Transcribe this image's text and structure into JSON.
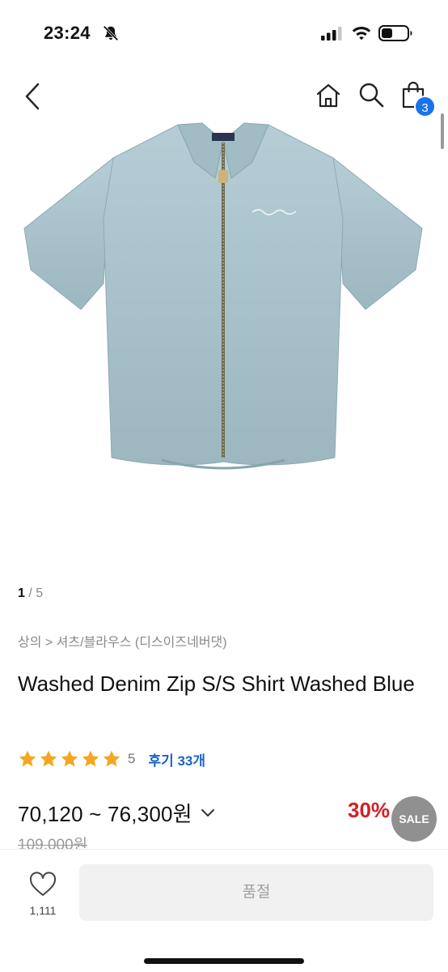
{
  "status_bar": {
    "time": "23:24",
    "icons": [
      "bell-slash-icon",
      "signal-icon",
      "wifi-icon",
      "battery-icon"
    ]
  },
  "header": {
    "icons": [
      "back-icon",
      "home-icon",
      "search-icon",
      "shopping-bag-icon"
    ],
    "cart_count": "3"
  },
  "gallery": {
    "current": "1",
    "separator": " / ",
    "total": "5"
  },
  "product": {
    "breadcrumb": "상의 > 셔츠/블라우스 (디스이즈네버댓)",
    "title": "Washed Denim Zip S/S Shirt Washed Blue",
    "rating": {
      "stars": 5,
      "value": "5",
      "review_label": "후기 33개"
    },
    "price_range": "70,120 ~ 76,300원",
    "discount": "30%",
    "original_price": "109,000원"
  },
  "sale_badge": "SALE",
  "bottom_bar": {
    "like_count": "1,111",
    "soldout_label": "품절"
  },
  "colors": {
    "accent_blue": "#1a73e8",
    "review_blue": "#1a64c8",
    "discount_red": "#d31f26",
    "star_orange": "#f5a623",
    "denim": "#a9c2cc"
  }
}
